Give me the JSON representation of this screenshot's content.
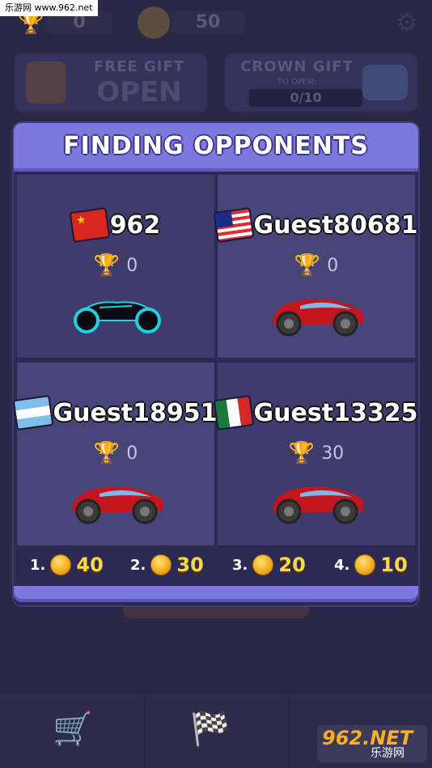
{
  "watermark": "乐游网 www.962.net",
  "topbar": {
    "trophies": "0",
    "coins": "50",
    "trophy_icon": "trophy-icon",
    "coin_icon": "coin-icon",
    "settings_icon": "gear-icon"
  },
  "gifts": {
    "free": {
      "title": "FREE GIFT",
      "status": "OPEN"
    },
    "crown": {
      "title": "CROWN GIFT",
      "subtitle": "TO OPEN:",
      "progress": "0/10"
    }
  },
  "dialog": {
    "title": "FINDING OPPONENTS",
    "players": [
      {
        "flag": "cn",
        "name": "962",
        "trophies": "0",
        "vehicle": "light-cycle"
      },
      {
        "flag": "my",
        "name": "Guest80681",
        "trophies": "0",
        "vehicle": "red-car"
      },
      {
        "flag": "ar",
        "name": "Guest18951",
        "trophies": "0",
        "vehicle": "red-car"
      },
      {
        "flag": "mx",
        "name": "Guest13325",
        "trophies": "30",
        "vehicle": "red-car"
      }
    ],
    "rewards": [
      {
        "rank": "1.",
        "coins": "40"
      },
      {
        "rank": "2.",
        "coins": "30"
      },
      {
        "rank": "3.",
        "coins": "20"
      },
      {
        "rank": "4.",
        "coins": "10"
      }
    ]
  },
  "logo": {
    "main": "962.NET",
    "sub": "乐游网"
  },
  "colors": {
    "accent": "#7d78dd",
    "coin": "#f2a917",
    "trophy": "#f2b51e"
  }
}
